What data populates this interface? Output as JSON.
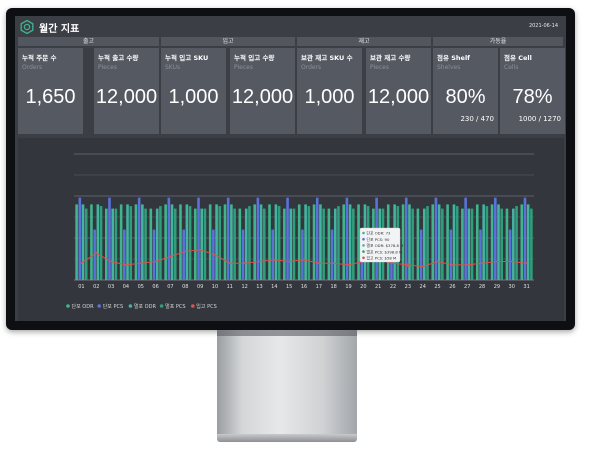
{
  "header": {
    "title": "월간 지표",
    "date": "2021-06-14"
  },
  "groups": [
    {
      "label": "출고"
    },
    {
      "label": "입고"
    },
    {
      "label": "재고"
    },
    {
      "label": "가동율"
    }
  ],
  "cards": [
    {
      "title": "누적 주문 수",
      "unit": "Orders",
      "value": "1,650",
      "sub": ""
    },
    {
      "title": "누적 출고 수량",
      "unit": "Pieces",
      "value": "12,000",
      "sub": ""
    },
    {
      "title": "누적 입고 SKU",
      "unit": "SKUs",
      "value": "1,000",
      "sub": ""
    },
    {
      "title": "누적 입고 수량",
      "unit": "Pieces",
      "value": "12,000",
      "sub": ""
    },
    {
      "title": "보관 재고 SKU 수",
      "unit": "Orders",
      "value": "1,000",
      "sub": ""
    },
    {
      "title": "보관 재고 수량",
      "unit": "Pieces",
      "value": "12,000",
      "sub": ""
    },
    {
      "title": "점유 Shelf",
      "unit": "Shelves",
      "value": "80%",
      "sub": "230 / 470"
    },
    {
      "title": "점유 Cell",
      "unit": "Cells",
      "value": "78%",
      "sub": "1000 / 1270"
    }
  ],
  "chart_data": {
    "type": "bar",
    "categories": [
      "01",
      "02",
      "03",
      "04",
      "05",
      "06",
      "07",
      "08",
      "09",
      "10",
      "11",
      "12",
      "13",
      "14",
      "15",
      "16",
      "17",
      "18",
      "19",
      "20",
      "21",
      "22",
      "23",
      "24",
      "25",
      "26",
      "27",
      "28",
      "29",
      "30",
      "31"
    ],
    "series": [
      {
        "name": "단포 ODR",
        "kind": "bar",
        "color": "#3fb58e",
        "values": [
          90,
          90,
          85,
          90,
          90,
          85,
          90,
          90,
          85,
          90,
          90,
          85,
          90,
          90,
          85,
          90,
          90,
          85,
          90,
          90,
          85,
          90,
          90,
          85,
          90,
          90,
          85,
          90,
          90,
          85,
          90
        ]
      },
      {
        "name": "단포 PCS",
        "kind": "bar",
        "color": "#5b73d9",
        "values": [
          98,
          60,
          98,
          60,
          98,
          60,
          98,
          60,
          98,
          60,
          98,
          60,
          98,
          60,
          98,
          60,
          98,
          60,
          98,
          60,
          98,
          60,
          98,
          60,
          98,
          60,
          98,
          60,
          98,
          60,
          98
        ]
      },
      {
        "name": "멀포 ODR",
        "kind": "bar",
        "color": "#45b3a2",
        "values": [
          90,
          90,
          85,
          90,
          90,
          85,
          90,
          90,
          85,
          90,
          90,
          85,
          90,
          90,
          85,
          90,
          90,
          85,
          90,
          90,
          85,
          90,
          90,
          85,
          90,
          90,
          85,
          90,
          90,
          85,
          90
        ]
      },
      {
        "name": "멀포 PCS",
        "kind": "bar",
        "color": "#2f9e7a",
        "values": [
          85,
          88,
          85,
          88,
          85,
          88,
          85,
          88,
          85,
          88,
          85,
          88,
          85,
          88,
          85,
          88,
          85,
          88,
          85,
          88,
          85,
          88,
          85,
          88,
          85,
          88,
          85,
          88,
          85,
          88,
          85
        ]
      },
      {
        "name": "입고 PCS",
        "kind": "line",
        "color": "#d9534f",
        "values": [
          20,
          32,
          22,
          18,
          20,
          22,
          28,
          34,
          36,
          30,
          20,
          20,
          22,
          24,
          22,
          24,
          20,
          20,
          18,
          22,
          24,
          20,
          18,
          16,
          22,
          18,
          18,
          20,
          22,
          22,
          20
        ]
      }
    ],
    "ylim": [
      0,
      150
    ],
    "tooltip": [
      "단포 ODR: 73",
      "단포 PCS: 90",
      "멀포 ODR: $378.8 M",
      "멀포 PCS: $398.8 M",
      "입고 PCS: $58 M"
    ],
    "legend_position": "bottom-left",
    "grid": true
  },
  "colors": {
    "accent": "#3fb58e",
    "panel": "#555962",
    "background": "#3b3e45"
  },
  "icons": {
    "logo": "hexagon-logo-icon"
  }
}
